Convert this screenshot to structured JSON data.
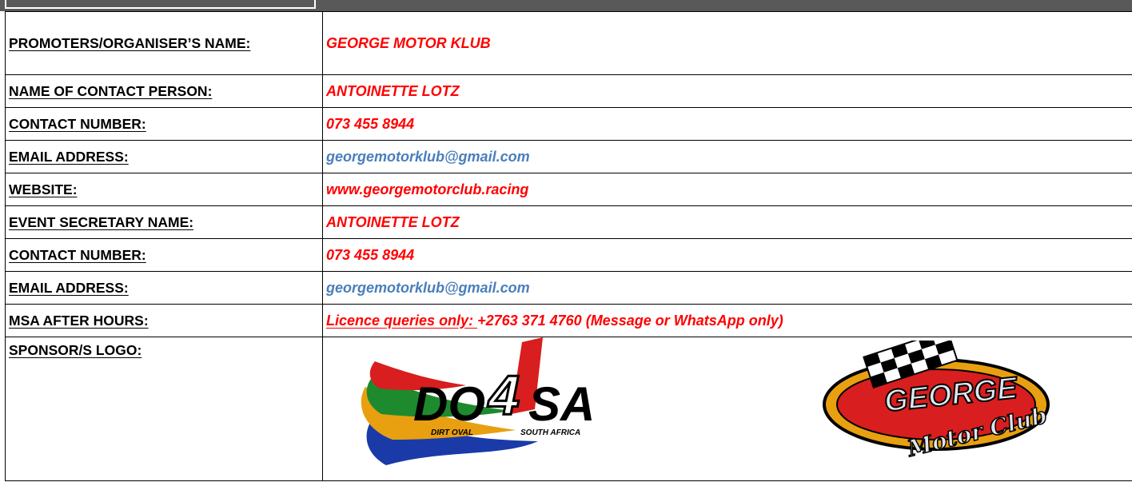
{
  "rows": [
    {
      "label": "PROMOTERS/ORGANISER’S NAME:",
      "value": "GEORGE MOTOR KLUB"
    },
    {
      "label": "NAME OF CONTACT PERSON:",
      "value": "ANTOINETTE LOTZ"
    },
    {
      "label": "CONTACT NUMBER:",
      "value": "073 455 8944"
    },
    {
      "label": "EMAIL ADDRESS:",
      "value": "georgemotorklub@gmail.com"
    },
    {
      "label": "WEBSITE:",
      "value": "www.georgemotorclub.racing"
    },
    {
      "label": "EVENT SECRETARY NAME:",
      "value": "ANTOINETTE LOTZ"
    },
    {
      "label": "CONTACT NUMBER:",
      "value": "073 455 8944"
    },
    {
      "label": "EMAIL ADDRESS:",
      "value": "georgemotorklub@gmail.com"
    },
    {
      "label": "MSA AFTER HOURS:",
      "value_prefix": "Licence queries only: ",
      "value": "+2763 371 4760 (Message or WhatsApp only)"
    },
    {
      "label": "SPONSOR/S LOGO:"
    }
  ],
  "logos": {
    "do4sa": {
      "text_main_left": "DO",
      "text_main_four": "4",
      "text_main_right": "SA",
      "text_sub_left": "DIRT OVAL",
      "text_sub_right": "SOUTH AFRICA"
    },
    "george": {
      "text_top": "GEORGE",
      "text_bottom": "Motor Club"
    }
  },
  "colors": {
    "value_red": "#ff0000",
    "email_blue": "#4a7ebb",
    "top_bar": "#595959"
  }
}
